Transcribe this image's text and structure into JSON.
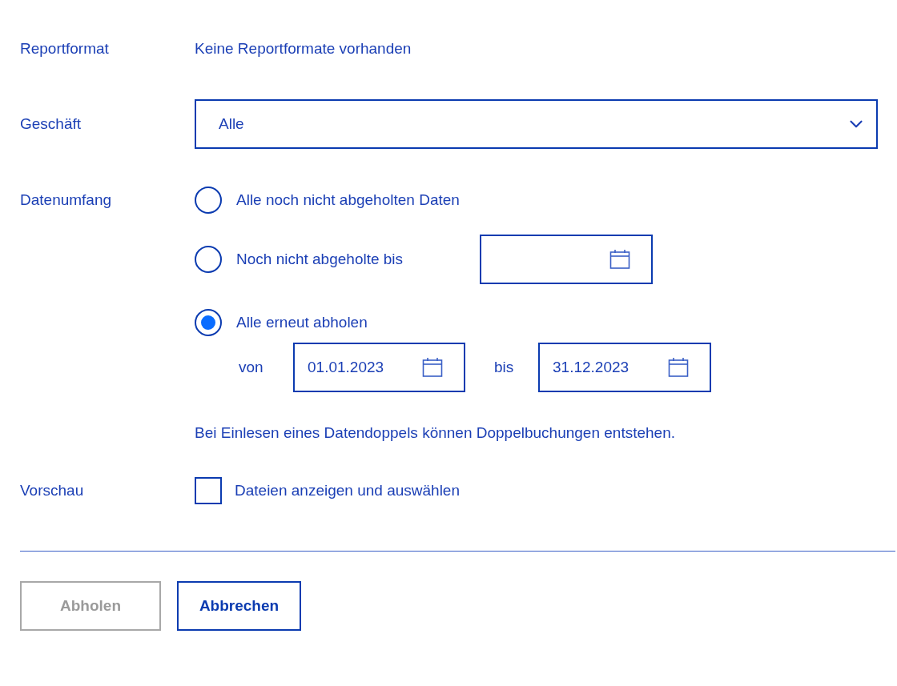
{
  "report_format": {
    "label": "Reportformat",
    "value": "Keine Reportformate vorhanden"
  },
  "business": {
    "label": "Geschäft",
    "value": "Alle"
  },
  "data_scope": {
    "label": "Datenumfang",
    "options": [
      {
        "kind": "plain",
        "label": "Alle noch nicht abgeholten Daten",
        "selected": false
      },
      {
        "kind": "until",
        "label": "Noch nicht abgeholte bis",
        "selected": false
      },
      {
        "kind": "range",
        "label": "Alle erneut abholen",
        "selected": true,
        "from_label": "von",
        "from": "01.01.2023",
        "to_label": "bis",
        "to": "31.12.2023"
      }
    ]
  },
  "note": "Bei Einlesen eines Datendoppels können Doppelbuchungen entstehen.",
  "preview": {
    "label": "Vorschau",
    "checkbox_label": "Dateien anzeigen und auswählen",
    "checked": false
  },
  "buttons": [
    {
      "label": "Abholen",
      "disabled": true
    },
    {
      "label": "Abbrechen",
      "disabled": false
    }
  ]
}
